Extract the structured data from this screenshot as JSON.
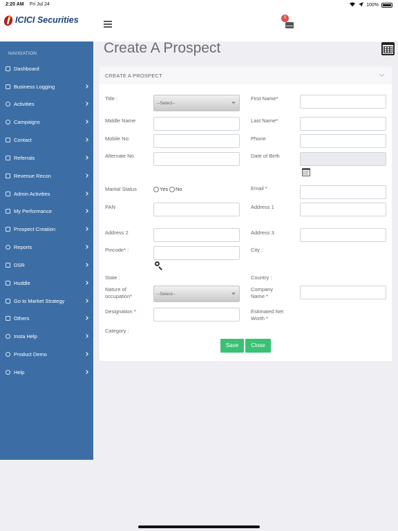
{
  "status_bar": {
    "time": "2:20 AM",
    "date": "Fri Jul 24",
    "battery": "100%"
  },
  "header": {
    "logo_text": "ICICI Securities",
    "notification_count": "0"
  },
  "sidebar": {
    "header": "NAVIGATION",
    "items": [
      {
        "label": "Dashboard",
        "icon": "monitor-icon",
        "chevron": false
      },
      {
        "label": "Business Logging",
        "icon": "key-icon",
        "chevron": true
      },
      {
        "label": "Activities",
        "icon": "clock-icon",
        "chevron": true
      },
      {
        "label": "Campaigns",
        "icon": "location-icon",
        "chevron": true
      },
      {
        "label": "Contact",
        "icon": "contact-icon",
        "chevron": true
      },
      {
        "label": "Referrals",
        "icon": "tag-icon",
        "chevron": true
      },
      {
        "label": "Revenue Recon",
        "icon": "inbox-icon",
        "chevron": true
      },
      {
        "label": "Admin Activities",
        "icon": "mail-icon",
        "chevron": true
      },
      {
        "label": "My Performance",
        "icon": "bar-chart-icon",
        "chevron": true
      },
      {
        "label": "Prospect Creation",
        "icon": "screen-icon",
        "chevron": true
      },
      {
        "label": "Reports",
        "icon": "settings-icon",
        "chevron": true
      },
      {
        "label": "DSR",
        "icon": "shield-icon",
        "chevron": true
      },
      {
        "label": "Huddle",
        "icon": "grid-icon",
        "chevron": true
      },
      {
        "label": "Go to Market Strategy",
        "icon": "window-icon",
        "chevron": true
      },
      {
        "label": "Others",
        "icon": "list-icon",
        "chevron": true
      },
      {
        "label": "Insta Help",
        "icon": "power-icon",
        "chevron": true
      },
      {
        "label": "Product Demo",
        "icon": "play-icon",
        "chevron": true
      },
      {
        "label": "Help",
        "icon": "info-icon",
        "chevron": true
      }
    ]
  },
  "page": {
    "title": "Create A Prospect"
  },
  "panel": {
    "title": "CREATE A PROSPECT",
    "title_label": "Title :",
    "title_select": "--Select--",
    "first_name": "First Name",
    "middle_name": "Middle Name",
    "last_name": "Last Name",
    "mobile_no": "Mobile No:",
    "phone": "Phone",
    "alternate_no": "Alternate No",
    "date_of_birth": "Date of Birth",
    "marital_status": "Marital Status",
    "yes": "Yes",
    "no": "No",
    "email": "Email",
    "pan": "PAN",
    "address1": "Address 1",
    "address2": "Address 2",
    "address3": "Address 3",
    "pincode": "Pincode",
    "city": "City :",
    "state": "State :",
    "country": "Country :",
    "nature_line1": "Nature of",
    "nature_line2": "occupation",
    "nature_select": "--Select--",
    "company_line1": "Company",
    "company_line2": "Name",
    "designation": "Designation",
    "net_worth_line1": "Estimated Net",
    "net_worth_line2": "Worth",
    "category": "Category :",
    "save": "Save",
    "close": "Close",
    "required_mark": "*",
    "pincode_suffix": " :"
  }
}
